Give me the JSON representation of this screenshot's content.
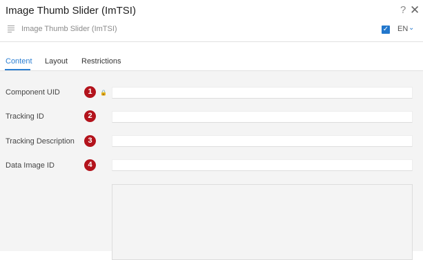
{
  "dialog": {
    "title": "Image Thumb Slider (ImTSI)",
    "help_icon": "?",
    "close_icon": "✕",
    "subtitle": "Image Thumb Slider (ImTSI)",
    "language": "EN",
    "language_checked": true
  },
  "tabs": [
    {
      "label": "Content",
      "active": true
    },
    {
      "label": "Layout",
      "active": false
    },
    {
      "label": "Restrictions",
      "active": false
    }
  ],
  "fields": [
    {
      "label": "Component UID",
      "badge": "1",
      "value": ""
    },
    {
      "label": "Tracking ID",
      "badge": "2",
      "value": ""
    },
    {
      "label": "Tracking Description",
      "badge": "3",
      "value": ""
    },
    {
      "label": "Data Image ID",
      "badge": "4",
      "value": ""
    }
  ],
  "colors": {
    "accent": "#2a7ed2",
    "badge": "#b3131c"
  },
  "icons": {
    "subtitle": "list-lines-icon",
    "uid_field": "lock-icon"
  }
}
